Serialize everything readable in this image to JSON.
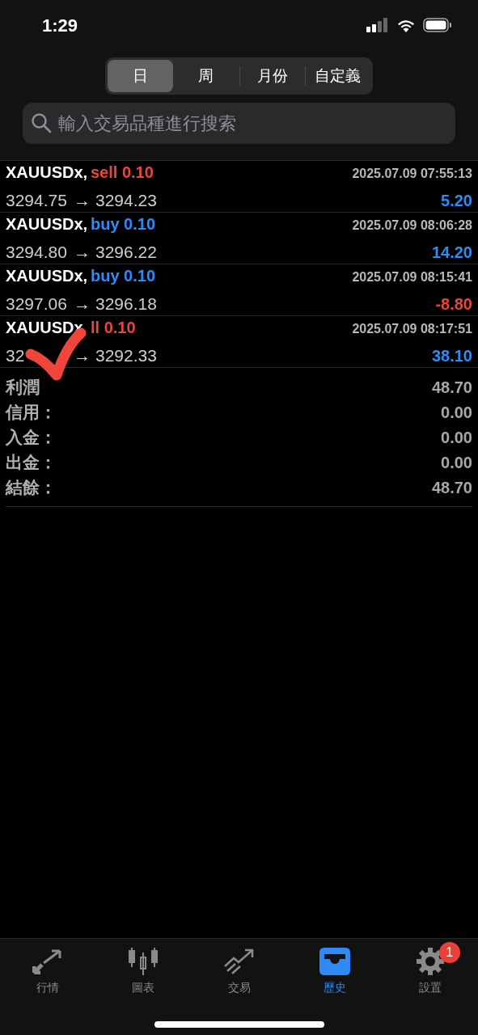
{
  "status_bar": {
    "time": "1:29"
  },
  "period_tabs": [
    {
      "label": "日",
      "selected": true
    },
    {
      "label": "周",
      "selected": false
    },
    {
      "label": "月份",
      "selected": false
    },
    {
      "label": "自定義",
      "selected": false
    }
  ],
  "search": {
    "placeholder": "輸入交易品種進行搜索"
  },
  "deals": [
    {
      "symbol": "XAUUSDx,",
      "kind": "sell",
      "side_label": "sell 0.10",
      "time": "2025.07.09 07:55:13",
      "open": "3294.75",
      "arrow": "→",
      "close": "3294.23",
      "profit": {
        "text": "5.20",
        "color": "#2f8af5"
      }
    },
    {
      "symbol": "XAUUSDx,",
      "kind": "buy",
      "side_label": "buy 0.10",
      "time": "2025.07.09 08:06:28",
      "open": "3294.80",
      "arrow": "→",
      "close": "3296.22",
      "profit": {
        "text": "14.20",
        "color": "#2f8af5"
      }
    },
    {
      "symbol": "XAUUSDx,",
      "kind": "buy",
      "side_label": "buy 0.10",
      "time": "2025.07.09 08:15:41",
      "open": "3297.06",
      "arrow": "→",
      "close": "3296.18",
      "profit": {
        "text": "-8.80",
        "color": "#e8463c"
      }
    },
    {
      "symbol": "XAUUSDx",
      "kind": "sell",
      "side_label": "ll 0.10",
      "time": "2025.07.09 08:17:51",
      "open": "32",
      "arrow": "→",
      "close": "3292.33",
      "profit": {
        "text": "38.10",
        "color": "#2f8af5"
      }
    }
  ],
  "summary": [
    {
      "label": "利潤",
      "value": "48.70"
    },
    {
      "label": "信用：",
      "value": "0.00"
    },
    {
      "label": "入金：",
      "value": "0.00"
    },
    {
      "label": "出金：",
      "value": "0.00"
    },
    {
      "label": "結餘：",
      "value": "48.70"
    }
  ],
  "tab_bar": [
    {
      "label": "行情",
      "selected": false
    },
    {
      "label": "圖表",
      "selected": false
    },
    {
      "label": "交易",
      "selected": false
    },
    {
      "label": "歷史",
      "selected": true
    },
    {
      "label": "設置",
      "selected": false,
      "badge": "1"
    }
  ]
}
